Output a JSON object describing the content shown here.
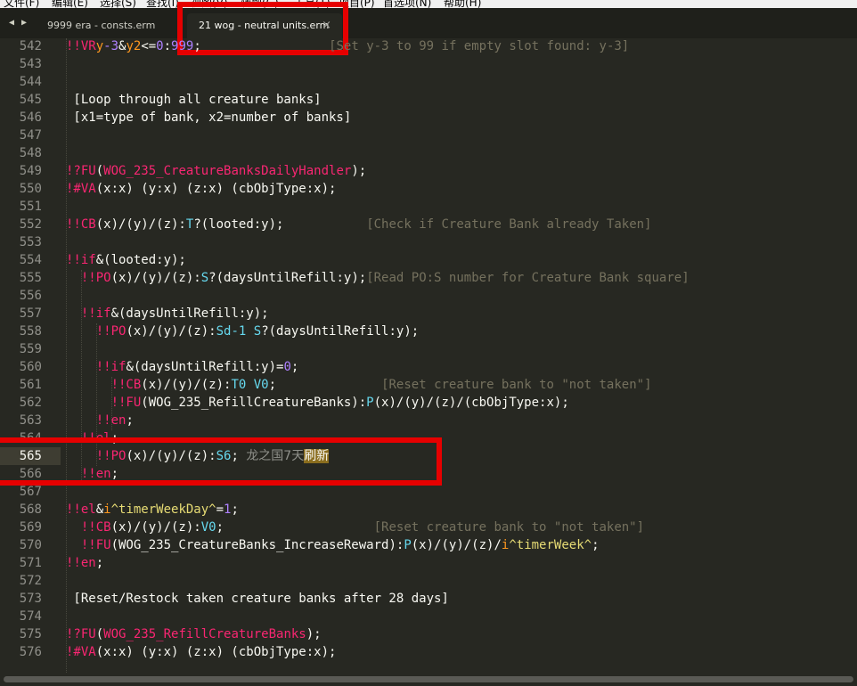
{
  "menubar": {
    "items": [
      "文件(F)",
      "编辑(E)",
      "选择(S)",
      "查找(I)",
      "视图(V)",
      "转到(G)",
      "工具(T)",
      "项目(P)",
      "首选项(N)",
      "帮助(H)"
    ]
  },
  "tabs": [
    {
      "label": "9999 era - consts.erm",
      "active": false
    },
    {
      "label": "21 wog - neutral units.erm",
      "active": true
    }
  ],
  "nav": {
    "back": "◀",
    "forward": "▶"
  },
  "close_glyph": "×",
  "current_line": "565",
  "lines": [
    {
      "n": "542",
      "tokens": [
        [
          "!!VR",
          "k-r"
        ],
        [
          "y",
          "k-o"
        ],
        [
          "-3",
          "k-v"
        ],
        [
          "&",
          "k-w"
        ],
        [
          "y2",
          "k-o"
        ],
        [
          "<=",
          "k-w"
        ],
        [
          "0",
          "k-v"
        ],
        [
          ":",
          "k-w"
        ],
        [
          "999",
          "k-v"
        ],
        [
          ";",
          "k-w"
        ],
        [
          "                 ",
          "k-w"
        ],
        [
          "[Set y-3 to 99 if empty slot found: y-3]",
          "k-c"
        ]
      ]
    },
    {
      "n": "543",
      "tokens": []
    },
    {
      "n": "544",
      "tokens": []
    },
    {
      "n": "545",
      "tokens": [
        [
          " [Loop through all creature banks]",
          "k-w"
        ]
      ]
    },
    {
      "n": "546",
      "tokens": [
        [
          " [x1=type of bank, x2=number of banks]",
          "k-w"
        ]
      ]
    },
    {
      "n": "547",
      "tokens": []
    },
    {
      "n": "548",
      "tokens": []
    },
    {
      "n": "549",
      "tokens": [
        [
          "!?FU",
          "k-r"
        ],
        [
          "(",
          "k-w"
        ],
        [
          "WOG_235_CreatureBanksDailyHandler",
          "k-r"
        ],
        [
          ");",
          "k-w"
        ]
      ]
    },
    {
      "n": "550",
      "tokens": [
        [
          "!#VA",
          "k-r"
        ],
        [
          "(x:x) (y:x) (z:x) (cbObjType:x);",
          "k-w"
        ]
      ]
    },
    {
      "n": "551",
      "tokens": []
    },
    {
      "n": "552",
      "tokens": [
        [
          "!!CB",
          "k-r"
        ],
        [
          "(x)/(y)/(z):",
          "k-w"
        ],
        [
          "T",
          "k-b"
        ],
        [
          "?(looted:y);",
          "k-w"
        ],
        [
          "           ",
          "k-w"
        ],
        [
          "[Check if Creature Bank already Taken]",
          "k-c"
        ]
      ]
    },
    {
      "n": "553",
      "tokens": []
    },
    {
      "n": "554",
      "tokens": [
        [
          "!!if",
          "k-r"
        ],
        [
          "&(looted:y);",
          "k-w"
        ]
      ]
    },
    {
      "n": "555",
      "tokens": [
        [
          "  !!PO",
          "k-r"
        ],
        [
          "(x)/(y)/(z):",
          "k-w"
        ],
        [
          "S",
          "k-b"
        ],
        [
          "?(daysUntilRefill:y);",
          "k-w"
        ],
        [
          "[Read PO:S number for Creature Bank square]",
          "k-c"
        ]
      ]
    },
    {
      "n": "556",
      "tokens": []
    },
    {
      "n": "557",
      "tokens": [
        [
          "  !!if",
          "k-r"
        ],
        [
          "&(daysUntilRefill:y);",
          "k-w"
        ]
      ]
    },
    {
      "n": "558",
      "tokens": [
        [
          "    !!PO",
          "k-r"
        ],
        [
          "(x)/(y)/(z):",
          "k-w"
        ],
        [
          "Sd-1",
          "k-b"
        ],
        [
          " ",
          "k-w"
        ],
        [
          "S",
          "k-b"
        ],
        [
          "?(daysUntilRefill:y);",
          "k-w"
        ]
      ]
    },
    {
      "n": "559",
      "tokens": []
    },
    {
      "n": "560",
      "tokens": [
        [
          "    !!if",
          "k-r"
        ],
        [
          "&(daysUntilRefill:y)=",
          "k-w"
        ],
        [
          "0",
          "k-v"
        ],
        [
          ";",
          "k-w"
        ]
      ]
    },
    {
      "n": "561",
      "tokens": [
        [
          "      !!CB",
          "k-r"
        ],
        [
          "(x)/(y)/(z):",
          "k-w"
        ],
        [
          "T0",
          "k-b"
        ],
        [
          " ",
          "k-w"
        ],
        [
          "V0",
          "k-b"
        ],
        [
          ";",
          "k-w"
        ],
        [
          "              ",
          "k-w"
        ],
        [
          "[Reset creature bank to \"not taken\"]",
          "k-c"
        ]
      ]
    },
    {
      "n": "562",
      "tokens": [
        [
          "      !!FU",
          "k-r"
        ],
        [
          "(WOG_235_RefillCreatureBanks):",
          "k-w"
        ],
        [
          "P",
          "k-b"
        ],
        [
          "(x)/(y)/(z)/(cbObjType:x);",
          "k-w"
        ]
      ]
    },
    {
      "n": "563",
      "tokens": [
        [
          "    !!en",
          "k-r"
        ],
        [
          ";",
          "k-w"
        ]
      ]
    },
    {
      "n": "564",
      "tokens": [
        [
          "  !!el",
          "k-r"
        ],
        [
          ";",
          "k-w"
        ]
      ]
    },
    {
      "n": "565",
      "tokens": [
        [
          "    !!PO",
          "k-r"
        ],
        [
          "(x)/(y)/(z):",
          "k-w"
        ],
        [
          "S6",
          "k-b"
        ],
        [
          "; ",
          "k-w"
        ],
        [
          "龙之国7天",
          "k-cn"
        ],
        [
          "刷新",
          "k-hl"
        ]
      ]
    },
    {
      "n": "566",
      "tokens": [
        [
          "  !!en",
          "k-r"
        ],
        [
          ";",
          "k-w"
        ]
      ]
    },
    {
      "n": "567",
      "tokens": []
    },
    {
      "n": "568",
      "tokens": [
        [
          "!!el",
          "k-r"
        ],
        [
          "&",
          "k-w"
        ],
        [
          "i",
          "k-o"
        ],
        [
          "^timerWeekDay^",
          "k-y"
        ],
        [
          "=",
          "k-w"
        ],
        [
          "1",
          "k-v"
        ],
        [
          ";",
          "k-w"
        ]
      ]
    },
    {
      "n": "569",
      "tokens": [
        [
          "  !!CB",
          "k-r"
        ],
        [
          "(x)/(y)/(z):",
          "k-w"
        ],
        [
          "V0",
          "k-b"
        ],
        [
          ";",
          "k-w"
        ],
        [
          "                    ",
          "k-w"
        ],
        [
          "[Reset creature bank to \"not taken\"]",
          "k-c"
        ]
      ]
    },
    {
      "n": "570",
      "tokens": [
        [
          "  !!FU",
          "k-r"
        ],
        [
          "(WOG_235_CreatureBanks_IncreaseReward):",
          "k-w"
        ],
        [
          "P",
          "k-b"
        ],
        [
          "(x)/(y)/(z)/",
          "k-w"
        ],
        [
          "i",
          "k-o"
        ],
        [
          "^timerWeek^",
          "k-y"
        ],
        [
          ";",
          "k-w"
        ]
      ]
    },
    {
      "n": "571",
      "tokens": [
        [
          "!!en",
          "k-r"
        ],
        [
          ";",
          "k-w"
        ]
      ]
    },
    {
      "n": "572",
      "tokens": []
    },
    {
      "n": "573",
      "tokens": [
        [
          " [Reset/Restock taken creature banks after 28 days]",
          "k-w"
        ]
      ]
    },
    {
      "n": "574",
      "tokens": []
    },
    {
      "n": "575",
      "tokens": [
        [
          "!?FU",
          "k-r"
        ],
        [
          "(",
          "k-w"
        ],
        [
          "WOG_235_RefillCreatureBanks",
          "k-r"
        ],
        [
          ");",
          "k-w"
        ]
      ]
    },
    {
      "n": "576",
      "tokens": [
        [
          "!#VA",
          "k-r"
        ],
        [
          "(x:x) (y:x) (z:x) (cbObjType:x);",
          "k-w"
        ]
      ]
    }
  ]
}
